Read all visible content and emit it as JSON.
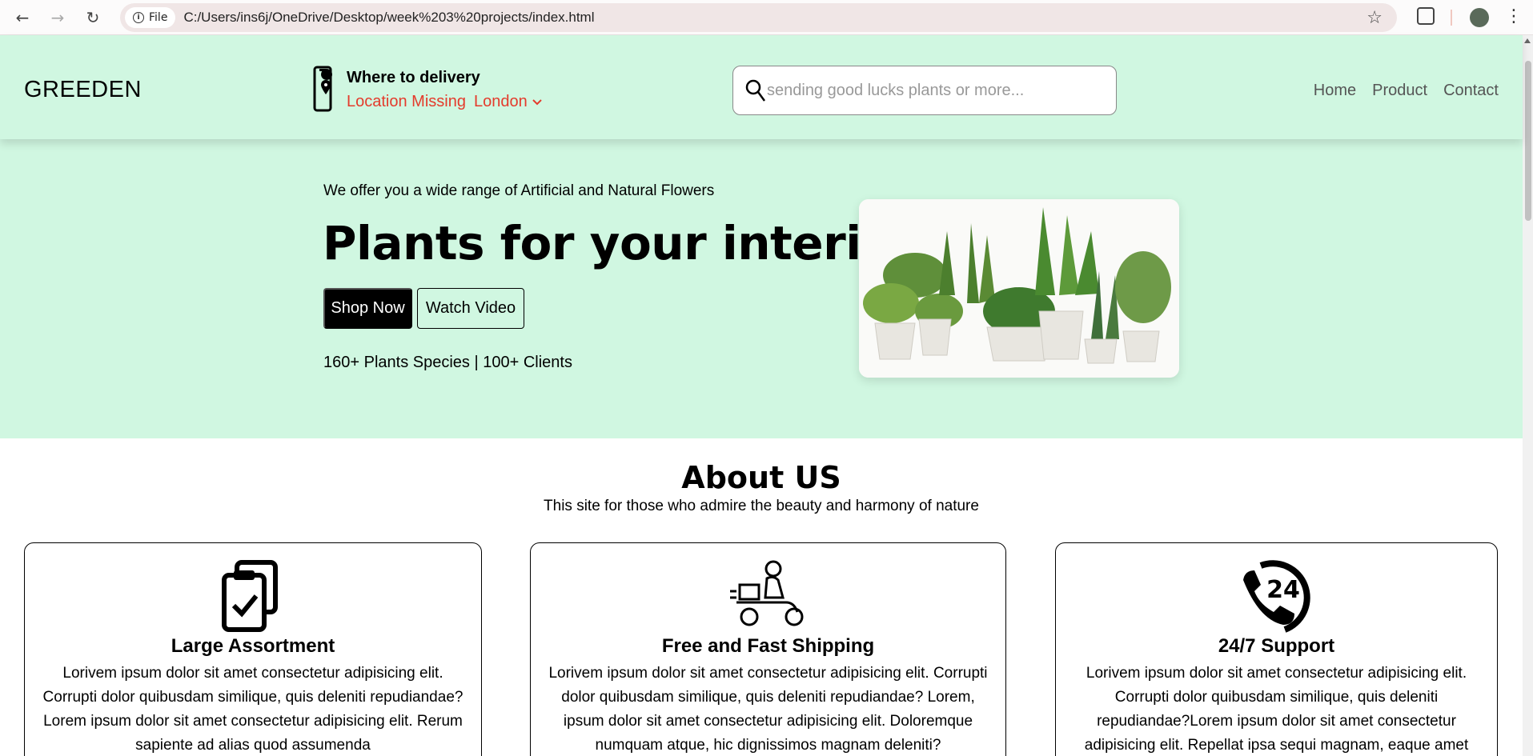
{
  "browser": {
    "file_chip": "File",
    "url": "C:/Users/ins6j/OneDrive/Desktop/week%203%20projects/index.html"
  },
  "header": {
    "logo": "GREEDEN",
    "delivery_title": "Where to delivery",
    "location_missing": "Location Missing",
    "location_selected": "London",
    "search_placeholder": "sending good lucks plants or more...",
    "nav": [
      "Home",
      "Product",
      "Contact"
    ]
  },
  "hero": {
    "kicker": "We offer you a wide range of Artificial and Natural Flowers",
    "title": "Plants for your interior",
    "shop_button": "Shop Now",
    "watch_button": "Watch Video",
    "stats": "160+ Plants Species | 100+ Clients"
  },
  "about": {
    "title": "About US",
    "subtitle": "This site for those who admire the beauty and harmony of nature",
    "cards": [
      {
        "icon": "clipboard-check-icon",
        "title": "Large Assortment",
        "body": "Lorivem ipsum dolor sit amet consectetur adipisicing elit. Corrupti dolor quibusdam similique, quis deleniti repudiandae?Lorem ipsum dolor sit amet consectetur adipisicing elit. Rerum sapiente ad alias quod assumenda"
      },
      {
        "icon": "delivery-scooter-icon",
        "title": "Free and Fast Shipping",
        "body": "Lorivem ipsum dolor sit amet consectetur adipisicing elit. Corrupti dolor quibusdam similique, quis deleniti repudiandae? Lorem, ipsum dolor sit amet consectetur adipisicing elit. Doloremque numquam atque, hic dignissimos magnam deleniti?"
      },
      {
        "icon": "support-24-7-icon",
        "title": "24/7 Support",
        "body": "Lorivem ipsum dolor sit amet consectetur adipisicing elit. Corrupti dolor quibusdam similique, quis deleniti repudiandae?Lorem ipsum dolor sit amet consectetur adipisicing elit. Repellat ipsa sequi magnam, eaque amet"
      }
    ]
  }
}
